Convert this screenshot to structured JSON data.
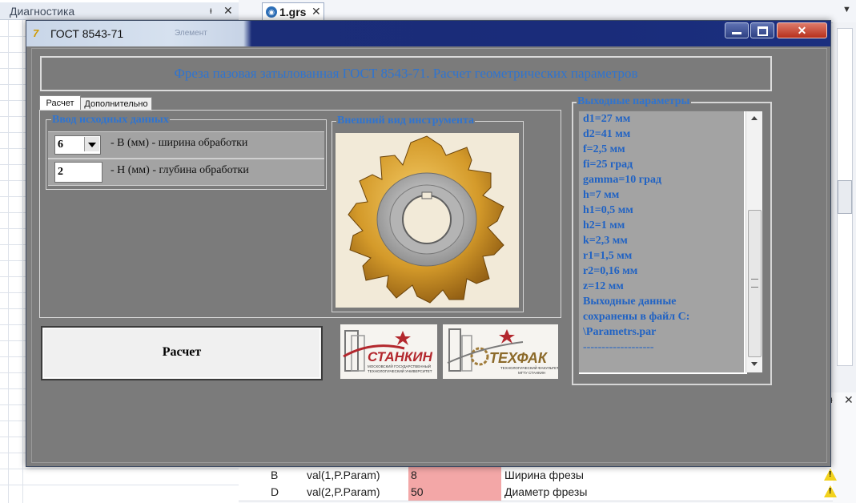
{
  "ide": {
    "diagnostics_title": "Диагностика",
    "pin_glyph": "ᵼ",
    "close_glyph": "✕",
    "document_tab": "1.grs",
    "document_tab_close": "✕",
    "properties": [
      {
        "name": "B",
        "expr": "val(1,P.Param)",
        "value": "8",
        "comment": "Ширина фрезы"
      },
      {
        "name": "D",
        "expr": "val(2,P.Param)",
        "value": "50",
        "comment": "Диаметр фрезы"
      }
    ]
  },
  "window": {
    "title": "ГОСТ 8543-71",
    "ghost_caption": "Элемент",
    "close_glyph": "✕",
    "header": "Фреза пазовая затылованная ГОСТ 8543-71. Расчет геометрических параметров",
    "tabs": [
      "Расчет",
      "Дополнительно"
    ],
    "input_group": {
      "title": "Ввод исходных данных",
      "b_value": "6",
      "b_label": "- B (мм) - ширина обработки",
      "h_value": "2",
      "h_label": "- H (мм) - глубина обработки"
    },
    "view_group_title": "Внешний вид инструмента",
    "calc_button": "Расчет",
    "logo1_text": "СТАНКИН",
    "logo2_text": "ТЕХФАК",
    "output": {
      "title": "Выходные параметры",
      "lines": [
        "d1=27 мм",
        "d2=41 мм",
        "f=2,5 мм",
        "fi=25 град",
        "gamma=10 град",
        "h=7 мм",
        "h1=0,5 мм",
        "h2=1 мм",
        "k=2,3 мм",
        "r1=1,5 мм",
        "r2=0,16 мм",
        "z=12 мм",
        "Выходные данные",
        "сохранены в файл С:",
        "\\Parametrs.par",
        "-------------------"
      ]
    }
  },
  "colors": {
    "accent_blue": "#2f74d0",
    "tool_gold": "#d49a2a",
    "warning_cell": "#f3a7a7",
    "logo_red": "#b3272d"
  }
}
